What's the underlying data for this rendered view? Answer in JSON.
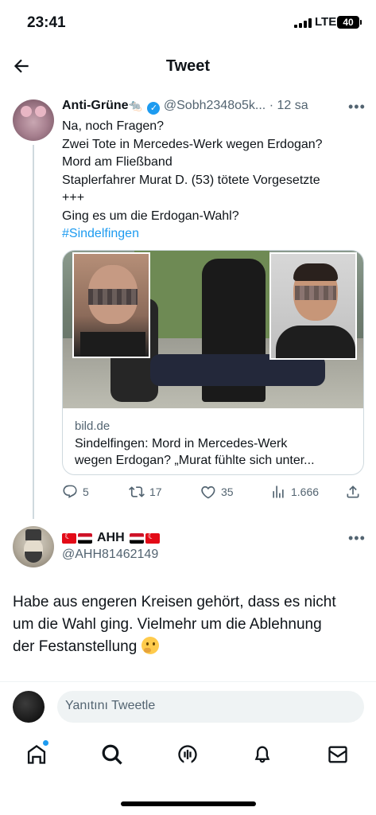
{
  "status_bar": {
    "time": "23:41",
    "network": "LTE",
    "battery": "40"
  },
  "header": {
    "title": "Tweet",
    "back_icon": "arrow-left-icon"
  },
  "tweet": {
    "author_name": "Anti-Grüne",
    "author_emoji": "🐀",
    "verified": true,
    "handle": "@Sobh2348o5k...",
    "time": "12 sa",
    "text_lines": [
      "Na, noch Fragen?",
      "Zwei Tote in Mercedes-Werk wegen Erdogan?",
      "Mord am Fließband",
      "Staplerfahrer Murat D. (53) tötete Vorgesetzte",
      "+++",
      "Ging es um die Erdogan-Wahl?"
    ],
    "hashtag": "#Sindelfingen",
    "card": {
      "domain": "bild.de",
      "title_line1": "Sindelfingen: Mord in Mercedes-Werk",
      "title_line2": "wegen Erdogan? „Murat fühlte sich unter..."
    },
    "stats": {
      "replies": "5",
      "retweets": "17",
      "likes": "35",
      "views": "1.666"
    }
  },
  "reply": {
    "author_name": "AHH",
    "handle": "@AHH81462149",
    "text_line1": "Habe aus engeren Kreisen gehört, dass es nicht",
    "text_line2": "um die Wahl ging. Vielmehr um die Ablehnung",
    "text_line3": "der Festanstellung"
  },
  "compose": {
    "placeholder": "Yanıtını Tweetle"
  },
  "colors": {
    "accent": "#1d9bf0",
    "text_primary": "#0f1419",
    "text_secondary": "#536471",
    "border": "#cfd9de"
  },
  "tabbar": {
    "items": [
      "home-icon",
      "search-icon",
      "spaces-icon",
      "notifications-icon",
      "messages-icon"
    ]
  }
}
